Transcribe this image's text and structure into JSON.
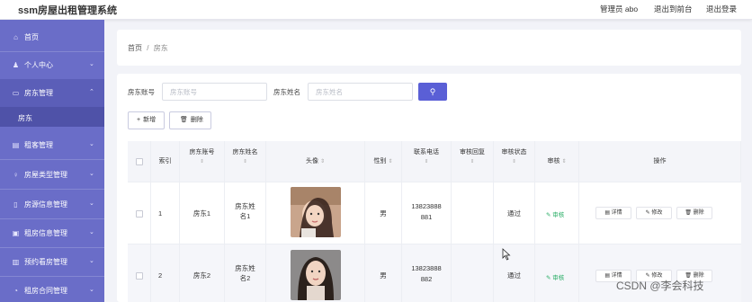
{
  "header": {
    "app_title": "ssm房屋出租管理系统",
    "admin_text": "管理员 abo",
    "back_link": "退出到前台",
    "logout_link": "退出登录"
  },
  "sidebar": {
    "items": [
      {
        "label": "首页",
        "icon": "home-icon"
      },
      {
        "label": "个人中心",
        "icon": "user-icon"
      },
      {
        "label": "房东管理",
        "icon": "landlord-icon"
      },
      {
        "label": "房东",
        "icon": ""
      },
      {
        "label": "租客管理",
        "icon": "tenant-icon"
      },
      {
        "label": "房屋类型管理",
        "icon": "type-icon"
      },
      {
        "label": "房源信息管理",
        "icon": "house-icon"
      },
      {
        "label": "租房信息管理",
        "icon": "rent-icon"
      },
      {
        "label": "预约看房管理",
        "icon": "appointment-icon"
      },
      {
        "label": "租房合同管理",
        "icon": "contract-icon"
      }
    ]
  },
  "breadcrumb": {
    "home": "首页",
    "sep": "/",
    "current": "房东"
  },
  "search": {
    "account_label": "房东账号",
    "account_placeholder": "房东账号",
    "name_label": "房东姓名",
    "name_placeholder": "房东姓名",
    "search_icon": "search-icon"
  },
  "toolbar": {
    "add_label": "新增",
    "delete_label": "删除"
  },
  "table": {
    "headers": {
      "index": "索引",
      "account": "房东账号",
      "name": "房东姓名",
      "avatar": "头像",
      "gender": "性别",
      "phone": "联系电话",
      "review_reply": "审核回复",
      "review_status": "审核状态",
      "review": "审核",
      "actions": "操作"
    },
    "sort_glyph": "⇕",
    "rows": [
      {
        "index": "1",
        "account": "房东1",
        "name": "房东姓名1",
        "gender": "男",
        "phone": "13823888881",
        "reply": "",
        "status": "通过",
        "review": "审核"
      },
      {
        "index": "2",
        "account": "房东2",
        "name": "房东姓名2",
        "gender": "男",
        "phone": "13823888882",
        "reply": "",
        "status": "通过",
        "review": "审核"
      }
    ],
    "actions": {
      "detail": "详情",
      "edit": "修改",
      "delete": "删除"
    }
  },
  "watermark": "CSDN @李会科技",
  "colors": {
    "sidebar": "#6a6dc8",
    "accent": "#5a5fd6",
    "review_green": "#2bae67"
  }
}
